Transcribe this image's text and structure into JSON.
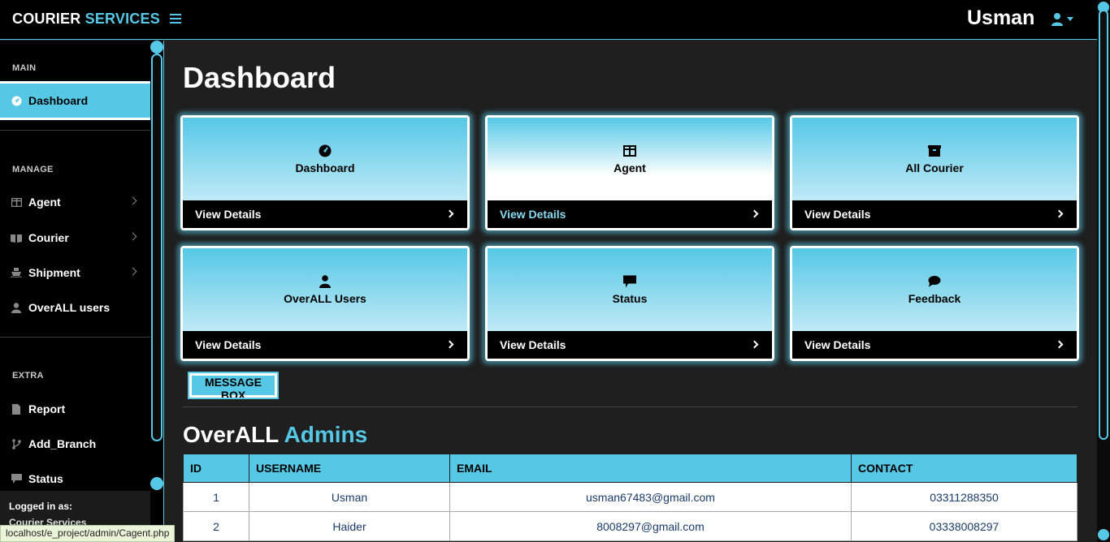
{
  "header": {
    "brand_part1": "COURIER",
    "brand_part2": "SERVICES",
    "username": "Usman"
  },
  "sidebar": {
    "sections": {
      "main": "MAIN",
      "manage": "MANAGE",
      "extra": "EXTRA"
    },
    "items": [
      {
        "label": "Dashboard",
        "icon": "dashboard-icon"
      },
      {
        "label": "Agent",
        "icon": "table-icon"
      },
      {
        "label": "Courier",
        "icon": "book-icon"
      },
      {
        "label": "Shipment",
        "icon": "ship-icon"
      },
      {
        "label": "OverALL users",
        "icon": "user-icon"
      },
      {
        "label": "Report",
        "icon": "file-icon"
      },
      {
        "label": "Add_Branch",
        "icon": "branch-icon"
      },
      {
        "label": "Status",
        "icon": "comment-icon"
      }
    ],
    "footer_line1": "Logged in as:",
    "footer_line2": "Courier Services"
  },
  "main": {
    "title": "Dashboard",
    "cards": [
      {
        "label": "Dashboard",
        "link": "View Details",
        "icon": "dashboard-icon"
      },
      {
        "label": "Agent",
        "link": "View Details",
        "icon": "table-icon"
      },
      {
        "label": "All Courier",
        "link": "View Details",
        "icon": "box-icon"
      },
      {
        "label": "OverALL Users",
        "link": "View Details",
        "icon": "user-icon"
      },
      {
        "label": "Status",
        "link": "View Details",
        "icon": "comment-icon"
      },
      {
        "label": "Feedback",
        "link": "View Details",
        "icon": "comments-icon"
      }
    ],
    "message_button": "MESSAGE BOX",
    "section_title_part1": "OverALL",
    "section_title_part2": "Admins",
    "table": {
      "headers": [
        "ID",
        "USERNAME",
        "EMAIL",
        "CONTACT"
      ],
      "rows": [
        [
          "1",
          "Usman",
          "usman67483@gmail.com",
          "03311288350"
        ],
        [
          "2",
          "Haider",
          "8008297@gmail.com",
          "03338008297"
        ]
      ]
    }
  },
  "status_bar_url": "localhost/e_project/admin/Cagent.php",
  "colors": {
    "accent": "#56c8e6",
    "background": "#1f1f1f",
    "topbar": "#000000"
  }
}
